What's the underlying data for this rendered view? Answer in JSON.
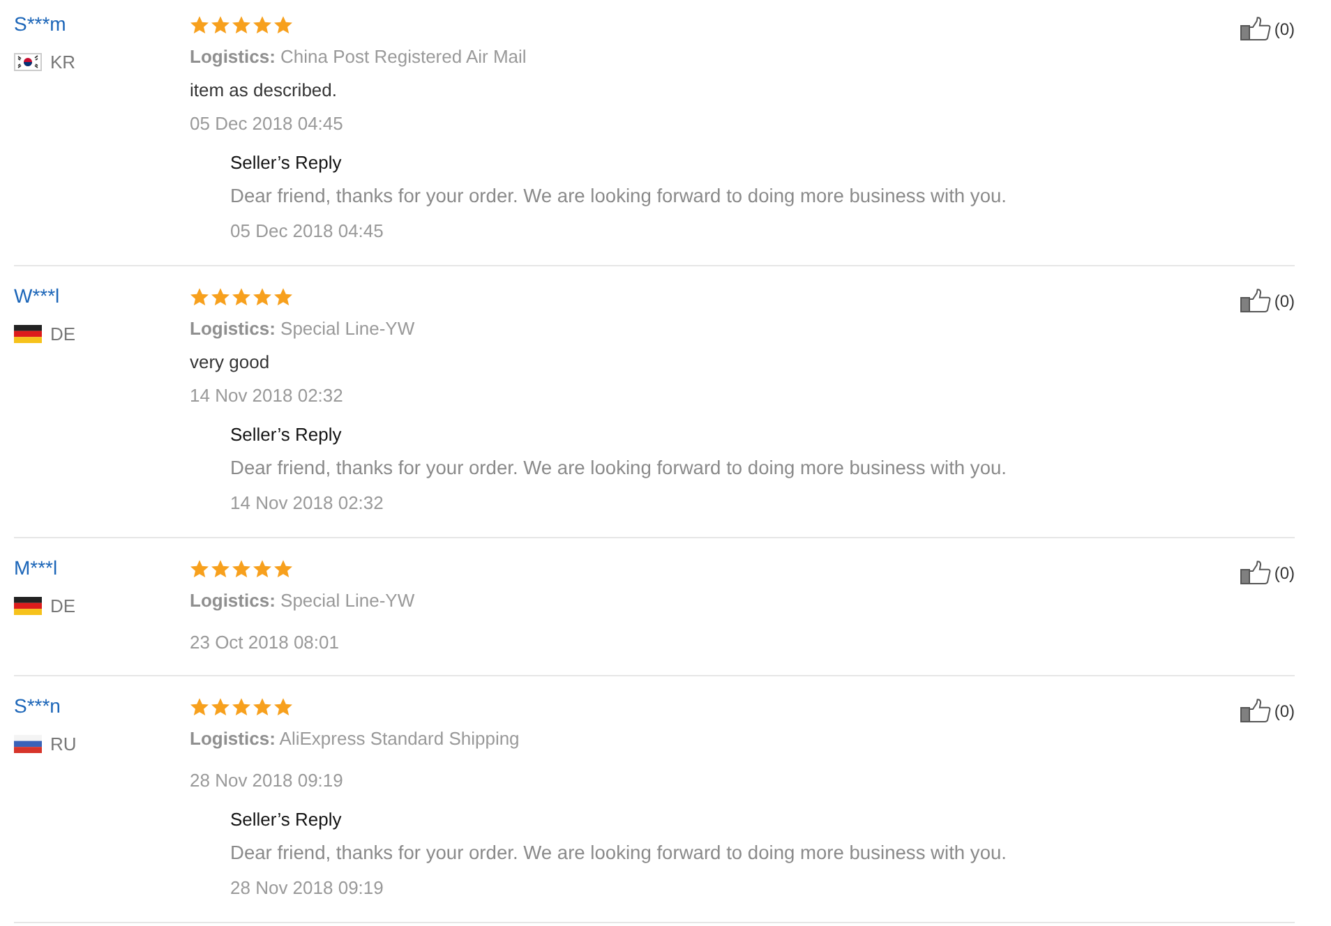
{
  "reviews": [
    {
      "reviewer": "S***m",
      "flag": {
        "kind": "south_korea"
      },
      "country": "KR",
      "stars": 5,
      "logistics": "**Logistics:** China Post Registered Air Mail",
      "feedback": "item as described.",
      "date": "05 Dec 2018 04:45",
      "likes": "(0)",
      "seller_reply": {
        "heading": "Seller’s Reply",
        "text": "Dear friend, thanks for your order. We are looking forward to doing more business with you.",
        "date": "05 Dec 2018 04:45"
      }
    },
    {
      "reviewer": "W***l",
      "flag": {
        "kind": "germany"
      },
      "country": "DE",
      "stars": 5,
      "logistics": "**Logistics:** Special Line-YW",
      "feedback": "very good",
      "date": "14 Nov 2018 02:32",
      "likes": "(0)",
      "seller_reply": {
        "heading": "Seller’s Reply",
        "text": "Dear friend, thanks for your order. We are looking forward to doing more business with you.",
        "date": "14 Nov 2018 02:32"
      }
    },
    {
      "reviewer": "M***l",
      "flag": {
        "kind": "germany"
      },
      "country": "DE",
      "stars": 5,
      "logistics": "**Logistics:** Special Line-YW",
      "date": "23 Oct 2018 08:01",
      "likes": "(0)"
    },
    {
      "reviewer": "S***n",
      "flag": {
        "kind": "russia"
      },
      "country": "RU",
      "stars": 5,
      "logistics": "**Logistics:** AliExpress Standard Shipping",
      "date": "28 Nov 2018 09:19",
      "likes": "(0)",
      "seller_reply": {
        "heading": "Seller’s Reply",
        "text": "Dear friend, thanks for your order. We are looking forward to doing more business with you.",
        "date": "28 Nov 2018 09:19"
      }
    }
  ]
}
